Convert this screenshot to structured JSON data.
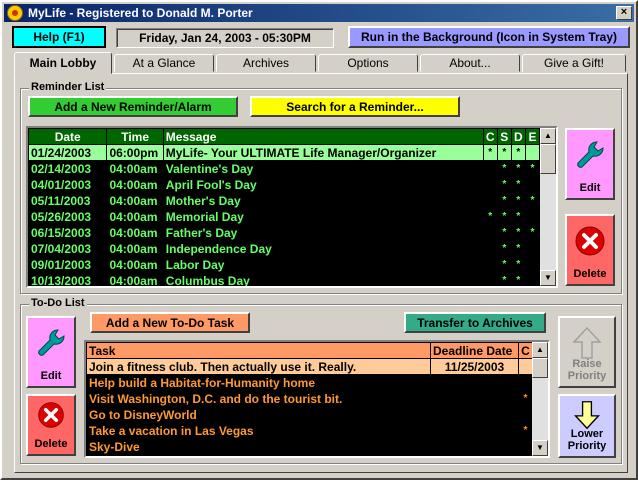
{
  "window": {
    "title": "MyLife - Registered to Donald M. Porter",
    "close_glyph": "×"
  },
  "toolbar": {
    "help_label": "Help (F1)",
    "date_text": "Friday, Jan 24, 2003 - 05:30PM",
    "background_label": "Run in the Background (Icon in System Tray)"
  },
  "tabs": [
    {
      "label": "Main Lobby",
      "active": true
    },
    {
      "label": "At a Glance"
    },
    {
      "label": "Archives"
    },
    {
      "label": "Options"
    },
    {
      "label": "About..."
    },
    {
      "label": "Give a Gift!"
    }
  ],
  "reminders": {
    "group_label": "Reminder List",
    "add_label": "Add a New Reminder/Alarm",
    "search_label": "Search for a Reminder...",
    "columns": [
      "Date",
      "Time",
      "Message",
      "C",
      "S",
      "D",
      "E"
    ],
    "rows": [
      {
        "date": "01/24/2003",
        "time": "06:00pm",
        "message": "MyLife- Your ULTIMATE Life Manager/Organizer",
        "c": "*",
        "s": "*",
        "d": "*",
        "e": ""
      },
      {
        "date": "02/14/2003",
        "time": "04:00am",
        "message": "Valentine's Day",
        "c": "",
        "s": "*",
        "d": "*",
        "e": "*"
      },
      {
        "date": "04/01/2003",
        "time": "04:00am",
        "message": "April Fool's Day",
        "c": "",
        "s": "*",
        "d": "*",
        "e": ""
      },
      {
        "date": "05/11/2003",
        "time": "04:00am",
        "message": "Mother's Day",
        "c": "",
        "s": "*",
        "d": "*",
        "e": "*"
      },
      {
        "date": "05/26/2003",
        "time": "04:00am",
        "message": "Memorial Day",
        "c": "*",
        "s": "*",
        "d": "*",
        "e": ""
      },
      {
        "date": "06/15/2003",
        "time": "04:00am",
        "message": "Father's Day",
        "c": "",
        "s": "*",
        "d": "*",
        "e": "*"
      },
      {
        "date": "07/04/2003",
        "time": "04:00am",
        "message": "Independence Day",
        "c": "",
        "s": "*",
        "d": "*",
        "e": ""
      },
      {
        "date": "09/01/2003",
        "time": "04:00am",
        "message": "Labor Day",
        "c": "",
        "s": "*",
        "d": "*",
        "e": ""
      },
      {
        "date": "10/13/2003",
        "time": "04:00am",
        "message": "Columbus Day",
        "c": "",
        "s": "*",
        "d": "*",
        "e": ""
      }
    ],
    "edit_label": "Edit",
    "delete_label": "Delete"
  },
  "todo": {
    "group_label": "To-Do List",
    "add_label": "Add a New To-Do Task",
    "transfer_label": "Transfer to Archives",
    "columns": [
      "Task",
      "Deadline Date",
      "C"
    ],
    "rows": [
      {
        "task": "Join a fitness club.  Then actually use it.  Really.",
        "deadline": "11/25/2003",
        "c": ""
      },
      {
        "task": "Help build a Habitat-for-Humanity home",
        "deadline": "",
        "c": ""
      },
      {
        "task": "Visit Washington, D.C. and do the tourist bit.",
        "deadline": "",
        "c": "*"
      },
      {
        "task": "Go to DisneyWorld",
        "deadline": "",
        "c": ""
      },
      {
        "task": "Take a vacation in Las Vegas",
        "deadline": "",
        "c": "*"
      },
      {
        "task": "Sky-Dive",
        "deadline": "",
        "c": ""
      }
    ],
    "edit_label": "Edit",
    "delete_label": "Delete",
    "raise_label": "Raise Priority",
    "lower_label": "Lower Priority"
  },
  "colors": {
    "reminder_header": "#006600",
    "reminder_text": "#66ff66",
    "todo_header": "#ff9966",
    "todo_text": "#ff9933",
    "help_button": "#00ffff",
    "background_button": "#9999ff",
    "add_reminder_button": "#33cc33",
    "search_button": "#ffff00",
    "add_todo_button": "#ff9966",
    "transfer_button": "#33aa88",
    "edit_button": "#ff99ff",
    "delete_button": "#ff6666"
  }
}
